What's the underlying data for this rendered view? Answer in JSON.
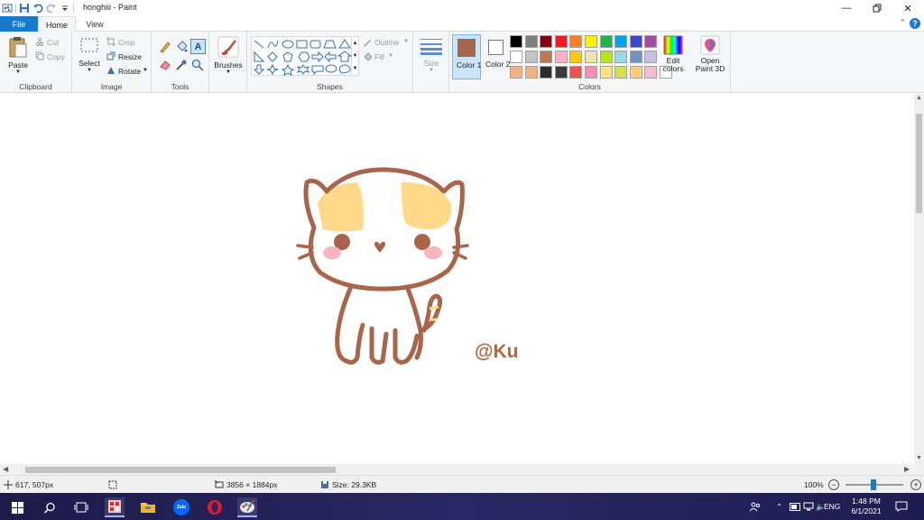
{
  "window": {
    "title": "honghiii - Paint",
    "minimize_icon": "minimize-icon",
    "restore_icon": "restore-icon",
    "close_icon": "close-icon"
  },
  "tabs": {
    "file": "File",
    "home": "Home",
    "view": "View"
  },
  "ribbon": {
    "clipboard": {
      "paste": "Paste",
      "cut": "Cut",
      "copy": "Copy",
      "group": "Clipboard"
    },
    "image": {
      "select": "Select",
      "crop": "Crop",
      "resize": "Resize",
      "rotate": "Rotate",
      "group": "Image"
    },
    "tools": {
      "group": "Tools",
      "text_glyph": "A"
    },
    "brushes": {
      "label": "Brushes"
    },
    "shapes": {
      "outline": "Outline",
      "fill": "Fill",
      "group": "Shapes"
    },
    "size": {
      "label": "Size"
    },
    "colors": {
      "color1": "Color 1",
      "color2": "Color 2",
      "color1_value": "#a8654a",
      "color2_value": "#ffffff",
      "group": "Colors",
      "edit_colors": "Edit colors",
      "palette_row1": [
        "#000000",
        "#7f7f7f",
        "#880015",
        "#ed1c24",
        "#ff7f27",
        "#fff200",
        "#22b14c",
        "#00a2e8",
        "#3f48cc",
        "#a349a4"
      ],
      "palette_row2": [
        "#ffffff",
        "#c3c3c3",
        "#b97a57",
        "#ffaec9",
        "#ffc90e",
        "#efe4b0",
        "#b5e61d",
        "#99d9ea",
        "#7092be",
        "#c8bfe7"
      ],
      "palette_row3": [
        "#f4b183",
        "#f4b183",
        "#2d2d2d",
        "#3a3a3a",
        "#ef5350",
        "#f48fb1",
        "#ffe082",
        "#d4e157",
        "#ffcc80",
        "#f8bbd0",
        "#ffffff"
      ]
    },
    "paint3d": {
      "label": "Open Paint 3D"
    }
  },
  "canvas": {
    "signature": "@Ku",
    "cat_outline_color": "#a8654a",
    "patch_color": "#ffd88a",
    "cheek_color": "#f8b4bc"
  },
  "status": {
    "cursor": "617, 507px",
    "dimensions": "3856 × 1884px",
    "size": "Size: 29.3KB",
    "zoom": "100%"
  },
  "taskbar": {
    "lang": "ENG",
    "time": "1:48 PM",
    "date": "6/1/2021",
    "zalo_label": "Zalo"
  }
}
